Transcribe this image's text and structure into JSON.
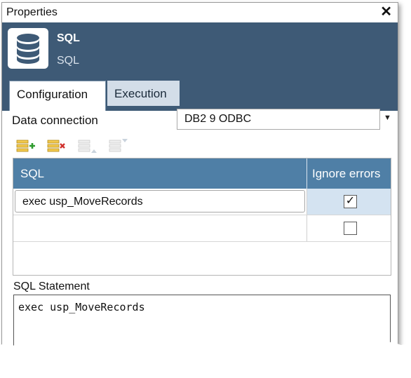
{
  "window": {
    "title": "Properties",
    "close_glyph": "✕"
  },
  "header": {
    "name": "SQL",
    "subtitle": "SQL",
    "icon": "database-icon"
  },
  "tabs": [
    {
      "label": "Configuration",
      "active": true
    },
    {
      "label": "Execution",
      "active": false
    }
  ],
  "data_connection": {
    "label": "Data connection",
    "value": "DB2 9 ODBC",
    "arrow": "▼"
  },
  "toolbar": {
    "buttons": [
      {
        "name": "add-row-icon",
        "enabled": true
      },
      {
        "name": "delete-row-icon",
        "enabled": true
      },
      {
        "name": "move-up-icon",
        "enabled": false
      },
      {
        "name": "move-down-icon",
        "enabled": false
      }
    ]
  },
  "grid": {
    "columns": [
      "SQL",
      "Ignore errors"
    ],
    "rows": [
      {
        "sql": "exec usp_MoveRecords",
        "ignore_errors": true,
        "check_glyph": "✓"
      },
      {
        "sql": "",
        "ignore_errors": false,
        "check_glyph": ""
      }
    ]
  },
  "statement": {
    "label": "SQL Statement",
    "text": "exec usp_MoveRecords"
  },
  "colors": {
    "header_bg": "#3e5a76",
    "grid_header_bg": "#4f7fa6",
    "tab_inactive_bg": "#d3dde8",
    "selected_cell": "#d4e3f1"
  }
}
